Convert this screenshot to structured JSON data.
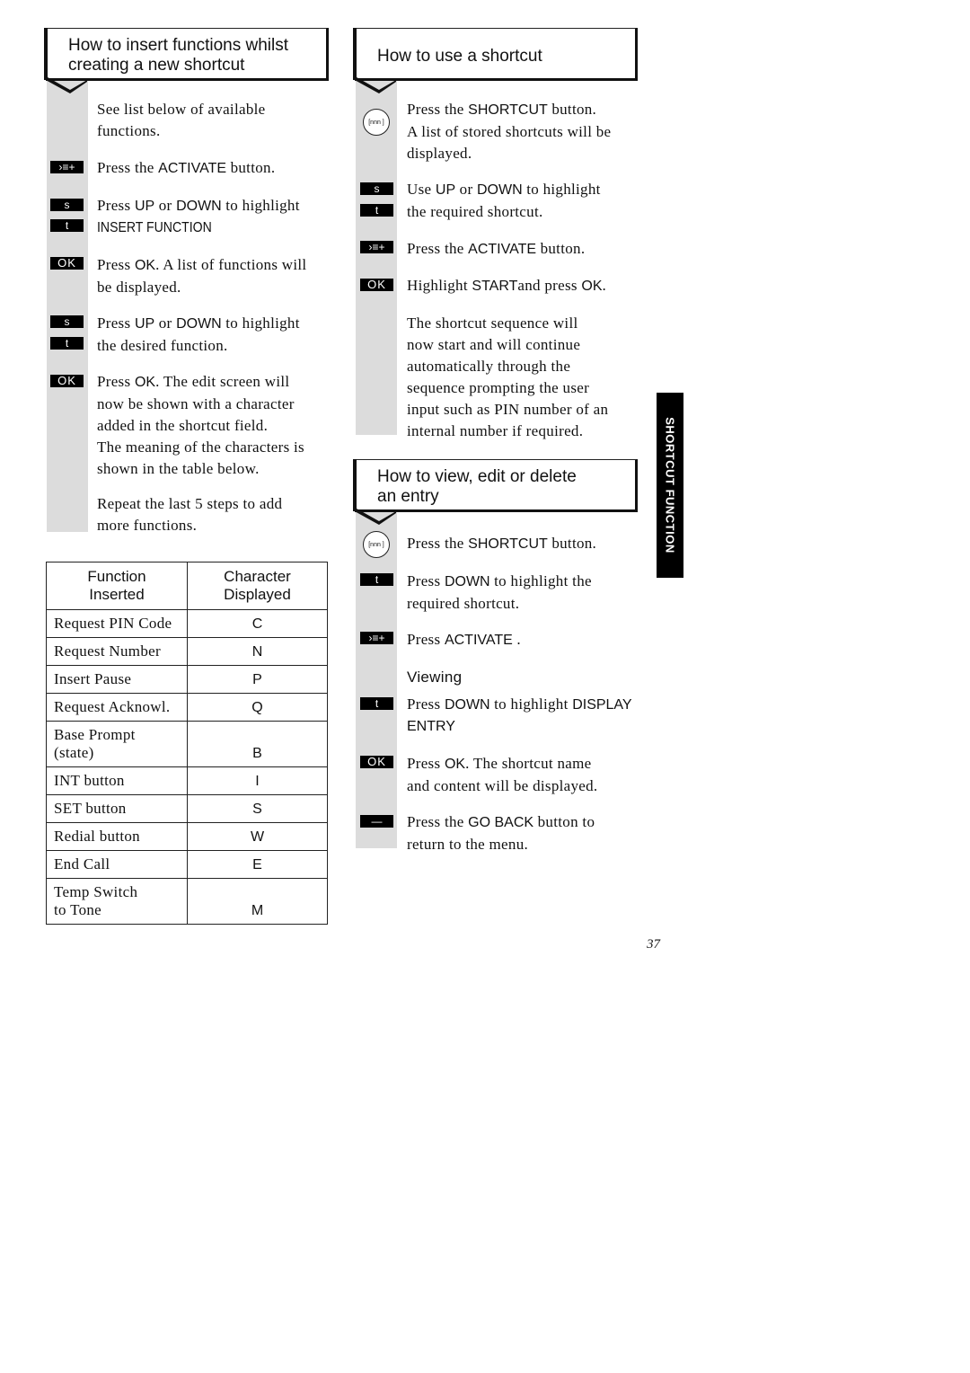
{
  "sections": {
    "insert": {
      "title_line1": "How to insert functions whilst",
      "title_line2": "creating a new shortcut",
      "steps": [
        {
          "icon": "none",
          "l1": "See list below of available",
          "l2": "functions."
        },
        {
          "icon": "activate-key",
          "pre": "Press the ",
          "key": "ACTIVATE",
          "post": " button."
        },
        {
          "icon": "up-down-keys",
          "pre": "Press ",
          "key": "UP",
          "mid": " or ",
          "key2": "DOWN",
          "post": " to highlight",
          "l2": "INSERT FUNCTION"
        },
        {
          "icon": "ok-key",
          "pre": "Press ",
          "key": "OK",
          "post": ". A list of functions will",
          "l2": "be displayed."
        },
        {
          "icon": "up-down-keys",
          "pre": "Press ",
          "key": "UP",
          "mid": " or ",
          "key2": "DOWN",
          "post": " to highlight",
          "l2": "the desired function."
        },
        {
          "icon": "ok-key",
          "pre": "Press ",
          "key": "OK",
          "post": ". The edit screen will",
          "l2": "now be shown with a character",
          "l3": "added in the shortcut field.",
          "l4": "The meaning of the characters is",
          "l5": "shown in the table below."
        },
        {
          "icon": "none",
          "l1": "Repeat the last 5 steps to add",
          "l2": "more functions."
        }
      ]
    },
    "use": {
      "title": "How to use a shortcut",
      "steps": [
        {
          "icon": "shortcut-key",
          "pre": "Press the ",
          "key": "SHORTCUT",
          "post": " button.",
          "l2": "A list of stored shortcuts will be",
          "l3": "displayed."
        },
        {
          "icon": "up-down-keys",
          "pre": "Use ",
          "key": "UP",
          "mid": " or ",
          "key2": "DOWN",
          "post": " to highlight",
          "l2": "the required shortcut."
        },
        {
          "icon": "activate-key",
          "pre": "Press the ",
          "key": "ACTIVATE",
          "post": " button."
        },
        {
          "icon": "ok-key",
          "pre": "Highlight ",
          "key": "START",
          "mid": "and press ",
          "key2": "OK",
          "post": "."
        },
        {
          "icon": "none",
          "l1": "The shortcut sequence will",
          "l2": "now start and will continue",
          "l3": "automatically through the",
          "l4": "sequence prompting the user",
          "l5": "input such as PIN number of an",
          "l6": "internal number if required."
        }
      ]
    },
    "view": {
      "title_line1": "How to view, edit or delete",
      "title_line2": "an entry",
      "subheading": "Viewing",
      "steps": [
        {
          "icon": "shortcut-key",
          "pre": "Press the ",
          "key": "SHORTCUT",
          "post": " button."
        },
        {
          "icon": "down-key",
          "pre": "Press ",
          "key": "DOWN",
          "post": " to highlight the",
          "l2": "required shortcut."
        },
        {
          "icon": "activate-key",
          "pre": "Press ",
          "key": "ACTIVATE",
          "post": " ."
        },
        {
          "icon": "down-key",
          "pre": "Press ",
          "key": "DOWN",
          "post": " to highlight ",
          "key2": "DISPLAY",
          "l2": "ENTRY"
        },
        {
          "icon": "ok-key",
          "pre": "Press ",
          "key": "OK",
          "post": ". The shortcut name",
          "l2": "and content will be displayed."
        },
        {
          "icon": "go-back-key",
          "pre": "Press the ",
          "key": "GO BACK",
          "post": " button to",
          "l2": "return to the menu."
        }
      ]
    }
  },
  "keys": {
    "up": "s",
    "down": "t",
    "ok": "OK",
    "shortcut": "[nnn ]",
    "activate": "›≡+",
    "goback": "—"
  },
  "table": {
    "headers": [
      "Function\nInserted",
      "Character\nDisplayed"
    ],
    "header1_l1": "Function",
    "header1_l2": "Inserted",
    "header2_l1": "Character",
    "header2_l2": "Displayed",
    "rows": [
      {
        "function": "Request PIN Code",
        "char": "C"
      },
      {
        "function": "Request Number",
        "char": "N"
      },
      {
        "function": "Insert Pause",
        "char": "P"
      },
      {
        "function": "Request Acknowl.",
        "char": "Q"
      },
      {
        "function": "Base Prompt",
        "function_l2": "(state)",
        "char": "B"
      },
      {
        "function": "INT button",
        "char": "I"
      },
      {
        "function": "SET button",
        "char": "S"
      },
      {
        "function": "Redial button",
        "char": "W"
      },
      {
        "function": "End Call",
        "char": "E"
      },
      {
        "function": "Temp Switch",
        "function_l2": "to Tone",
        "char": "M"
      }
    ]
  },
  "side_tab": "SHORTCUT FUNCTION",
  "page_number": "37"
}
